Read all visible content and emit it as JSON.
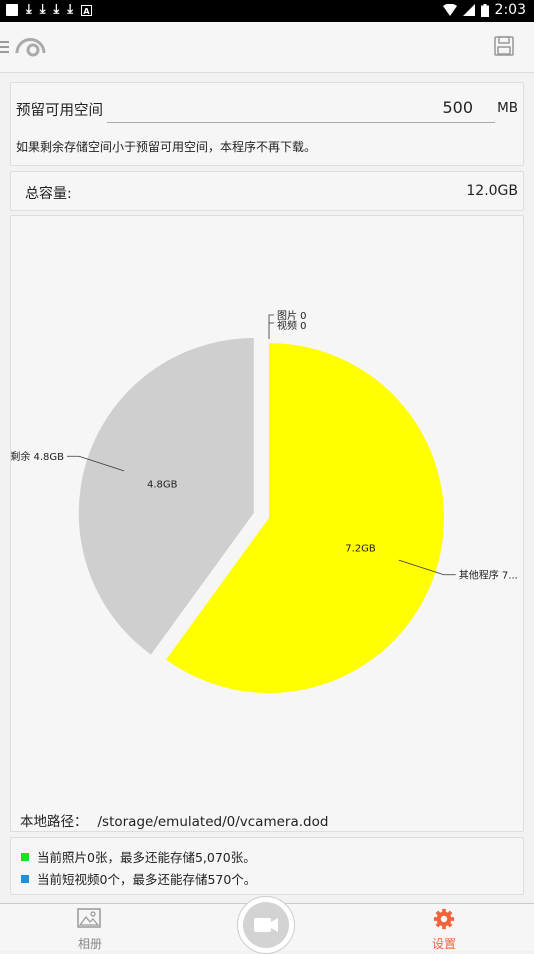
{
  "status_bar": {
    "time": "2:03"
  },
  "reserve": {
    "label": "预留可用空间",
    "value": "500",
    "unit": "MB",
    "note": "如果剩余存储空间小于预留可用空间，本程序不再下载。"
  },
  "total": {
    "label": "总容量:",
    "value": "12.0GB"
  },
  "chart_data": {
    "type": "pie",
    "slices": [
      {
        "label": "其他程序 7...",
        "value": 7.2,
        "inner_label": "7.2GB",
        "color": "#ffff00"
      },
      {
        "label": "剩余 4.8GB",
        "value": 4.8,
        "inner_label": "4.8GB",
        "color": "#cfcfcf"
      },
      {
        "label": "图片 0",
        "value": 0,
        "inner_label": "",
        "color": "#00c800"
      },
      {
        "label": "视频 0",
        "value": 0,
        "inner_label": "",
        "color": "#1e90dc"
      }
    ]
  },
  "path": {
    "label": "本地路径：",
    "value": "/storage/emulated/0/vcamera.dod"
  },
  "info": {
    "photos": "当前照片0张，最多还能存储5,070张。",
    "videos": "当前短视频0个，最多还能存储570个。",
    "photo_color": "#22dd22",
    "video_color": "#1e90dc"
  },
  "nav": {
    "album_label": "相册",
    "settings_label": "设置",
    "accent": "#f0643c"
  }
}
